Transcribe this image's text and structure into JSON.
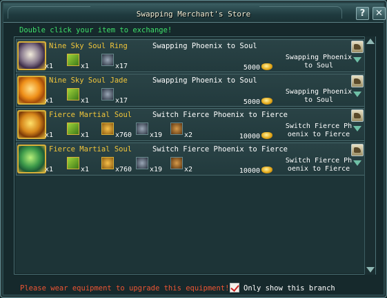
{
  "window": {
    "title": "Swapping Merchant's Store",
    "help_label": "?",
    "close_label": "✕"
  },
  "hint": "Double click your item to exchange!",
  "rows": [
    {
      "item_name": "Nine Sky Soul Ring",
      "recipe": "Swapping Phoenix to Soul",
      "item_qty": "x1",
      "mats": [
        {
          "icon": "scroll-icon",
          "qty": "x1"
        },
        {
          "icon": "grey-gem-icon",
          "qty": "x17"
        }
      ],
      "price": "5000",
      "result_line1": "Swapping Phoenix",
      "result_line2": "to Soul"
    },
    {
      "item_name": "Nine Sky Soul Jade",
      "recipe": "Swapping Phoenix to Soul",
      "item_qty": "x1",
      "mats": [
        {
          "icon": "scroll-icon",
          "qty": "x1"
        },
        {
          "icon": "grey-gem-icon",
          "qty": "x17"
        }
      ],
      "price": "5000",
      "result_line1": "Swapping Phoenix",
      "result_line2": "to Soul"
    },
    {
      "item_name": "Fierce Martial Soul",
      "recipe": "Switch Fierce Phoenix to Fierce",
      "item_qty": "x1",
      "mats": [
        {
          "icon": "scroll-icon",
          "qty": "x1"
        },
        {
          "icon": "gold-gem-icon",
          "qty": "x760"
        },
        {
          "icon": "grey-gem-icon",
          "qty": "x19"
        },
        {
          "icon": "brown-gem-icon",
          "qty": "x2"
        }
      ],
      "price": "10000",
      "result_line1": "Switch Fierce Ph",
      "result_line2": "oenix to Fierce"
    },
    {
      "item_name": "Fierce Martial Soul",
      "recipe": "Switch Fierce Phoenix to Fierce",
      "item_qty": "x1",
      "mats": [
        {
          "icon": "scroll-icon",
          "qty": "x1"
        },
        {
          "icon": "gold-gem-icon",
          "qty": "x760"
        },
        {
          "icon": "grey-gem-icon",
          "qty": "x19"
        },
        {
          "icon": "brown-gem-icon",
          "qty": "x2"
        }
      ],
      "price": "10000",
      "result_line1": "Switch Fierce Ph",
      "result_line2": "oenix to Fierce"
    }
  ],
  "footer": {
    "warning": "Please wear equipment to upgrade this equipment!",
    "branch_label": "Only show this branch",
    "branch_checked": true
  },
  "colors": {
    "hint": "#3ee06a",
    "item_name": "#f2c63a",
    "warning": "#ee5533"
  }
}
